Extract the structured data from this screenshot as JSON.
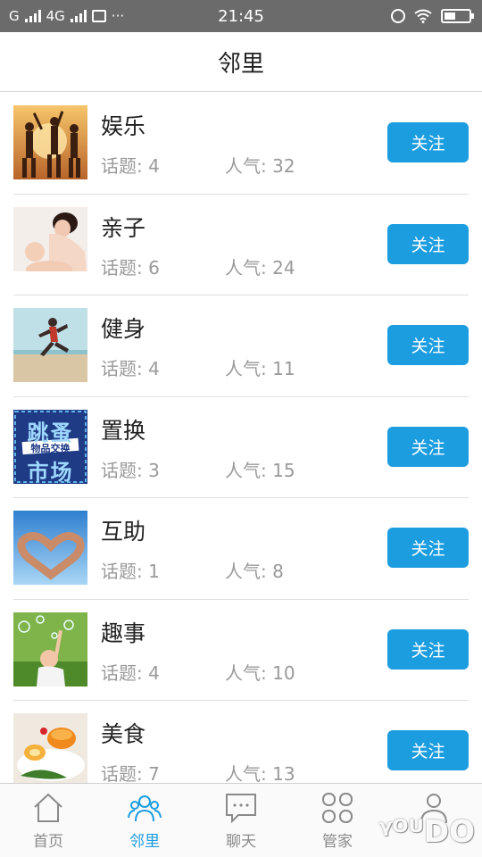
{
  "status_bar": {
    "carrier": "G",
    "network": "4G",
    "time": "21:45"
  },
  "header": {
    "title": "邻里"
  },
  "groups": [
    {
      "name": "娱乐",
      "topics": "话题: 4",
      "popularity": "人气: 32",
      "follow_label": "关注",
      "thumb_icon": "party-photo"
    },
    {
      "name": "亲子",
      "topics": "话题: 6",
      "popularity": "人气: 24",
      "follow_label": "关注",
      "thumb_icon": "parent-child-photo"
    },
    {
      "name": "健身",
      "topics": "话题: 4",
      "popularity": "人气: 11",
      "follow_label": "关注",
      "thumb_icon": "running-photo"
    },
    {
      "name": "置换",
      "topics": "话题: 3",
      "popularity": "人气: 15",
      "follow_label": "关注",
      "thumb_icon": "flea-market-sign",
      "thumb_text_top": "跳蚤",
      "thumb_text_mid": "物品交换",
      "thumb_text_bottom": "市场"
    },
    {
      "name": "互助",
      "topics": "话题: 1",
      "popularity": "人气: 8",
      "follow_label": "关注",
      "thumb_icon": "heart-hands-photo"
    },
    {
      "name": "趣事",
      "topics": "话题: 4",
      "popularity": "人气: 10",
      "follow_label": "关注",
      "thumb_icon": "child-bubbles-photo"
    },
    {
      "name": "美食",
      "topics": "话题: 7",
      "popularity": "人气: 13",
      "follow_label": "关注",
      "thumb_icon": "food-plate-photo"
    }
  ],
  "tabs": [
    {
      "label": "首页",
      "icon": "home-icon"
    },
    {
      "label": "邻里",
      "icon": "people-icon",
      "active": true
    },
    {
      "label": "聊天",
      "icon": "chat-icon"
    },
    {
      "label": "管家",
      "icon": "grid-icon"
    },
    {
      "label": "",
      "icon": "person-icon"
    }
  ],
  "watermark": "ᵞᴼᵁ𝗗𝗢",
  "colors": {
    "accent": "#1c9de0",
    "status_bar": "#6b6b6b"
  }
}
